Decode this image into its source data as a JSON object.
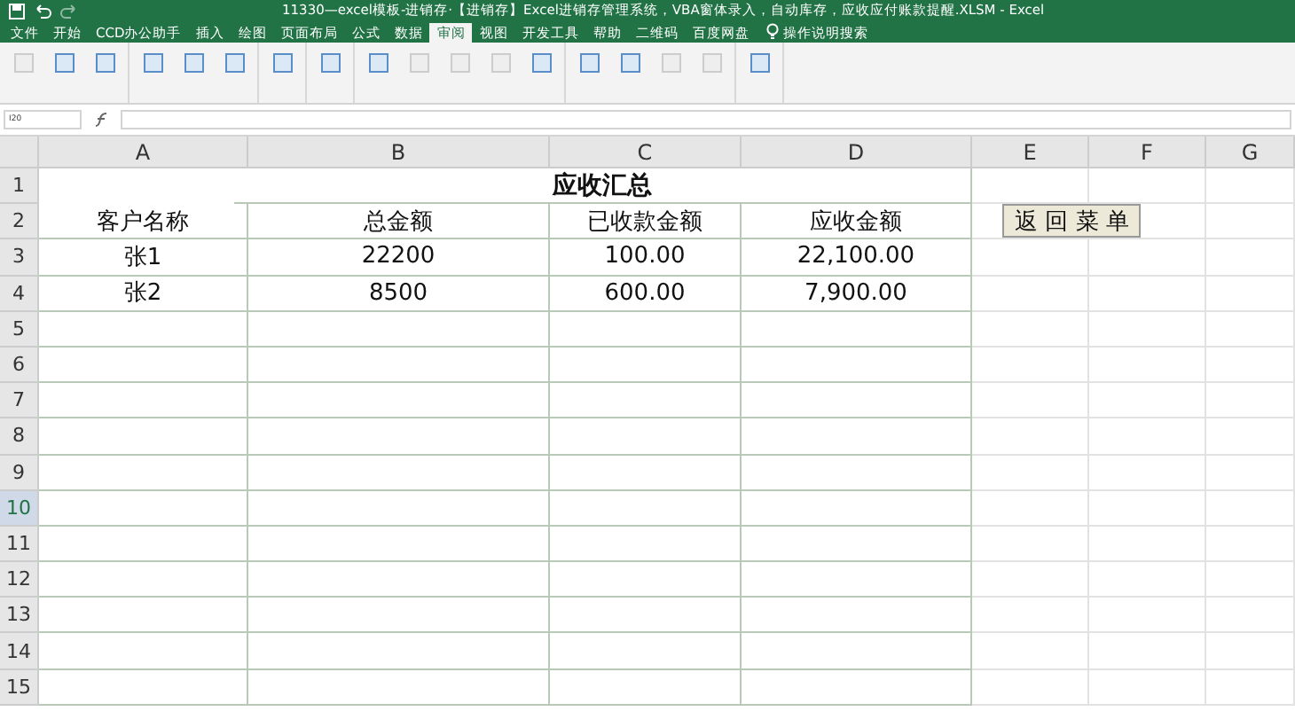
{
  "window": {
    "title": "11330—excel模板-进销存·【进销存】Excel进销存管理系统，VBA窗体录入，自动库存，应收应付账款提醒.XLSM  -  Excel"
  },
  "ribbon_tabs": [
    {
      "label": "文件",
      "selected": false
    },
    {
      "label": "开始",
      "selected": false
    },
    {
      "label": "CCD办公助手",
      "selected": false
    },
    {
      "label": "插入",
      "selected": false
    },
    {
      "label": "绘图",
      "selected": false
    },
    {
      "label": "页面布局",
      "selected": false
    },
    {
      "label": "公式",
      "selected": false
    },
    {
      "label": "数据",
      "selected": false
    },
    {
      "label": "审阅",
      "selected": true
    },
    {
      "label": "视图",
      "selected": false
    },
    {
      "label": "开发工具",
      "selected": false
    },
    {
      "label": "帮助",
      "selected": false
    },
    {
      "label": "二维码",
      "selected": false
    },
    {
      "label": "百度网盘",
      "selected": false
    }
  ],
  "tell_me": "操作说明搜索",
  "ribbon_groups": [
    {
      "buttons": [
        {
          "disabled": true
        },
        {
          "disabled": false
        },
        {
          "disabled": false
        }
      ]
    },
    {
      "buttons": [
        {
          "disabled": false
        },
        {
          "disabled": false
        },
        {
          "disabled": false
        }
      ]
    },
    {
      "buttons": [
        {
          "disabled": false
        }
      ]
    },
    {
      "buttons": [
        {
          "disabled": false
        }
      ]
    },
    {
      "buttons": [
        {
          "disabled": false
        },
        {
          "disabled": true
        },
        {
          "disabled": true
        },
        {
          "disabled": true
        },
        {
          "disabled": false
        }
      ]
    },
    {
      "buttons": [
        {
          "disabled": false
        },
        {
          "disabled": false
        },
        {
          "disabled": true
        },
        {
          "disabled": true
        }
      ]
    },
    {
      "buttons": [
        {
          "disabled": false
        }
      ]
    }
  ],
  "name_box": "I20",
  "columns": [
    {
      "label": "A",
      "selected": false
    },
    {
      "label": "B",
      "selected": false
    },
    {
      "label": "C",
      "selected": false
    },
    {
      "label": "D",
      "selected": false
    },
    {
      "label": "E",
      "selected": false
    },
    {
      "label": "F",
      "selected": false
    },
    {
      "label": "G",
      "selected": false
    }
  ],
  "row_headers": [
    {
      "label": "1",
      "selected": false
    },
    {
      "label": "2",
      "selected": false
    },
    {
      "label": "3",
      "selected": false
    },
    {
      "label": "4",
      "selected": false
    },
    {
      "label": "5",
      "selected": false
    },
    {
      "label": "6",
      "selected": false
    },
    {
      "label": "7",
      "selected": false
    },
    {
      "label": "8",
      "selected": false
    },
    {
      "label": "9",
      "selected": false
    },
    {
      "label": "10",
      "selected": true
    },
    {
      "label": "11",
      "selected": false
    },
    {
      "label": "12",
      "selected": false
    },
    {
      "label": "13",
      "selected": false
    },
    {
      "label": "14",
      "selected": false
    },
    {
      "label": "15",
      "selected": false
    }
  ],
  "sheet_title": "应收汇总",
  "table_header": [
    "客户名称",
    "总金额",
    "已收款金额",
    "应收金额"
  ],
  "table_rows": [
    [
      "张1",
      "22200",
      "100.00",
      "22,100.00"
    ],
    [
      "张2",
      "8500",
      "600.00",
      "7,900.00"
    ]
  ],
  "back_button": "返 回 菜 单"
}
